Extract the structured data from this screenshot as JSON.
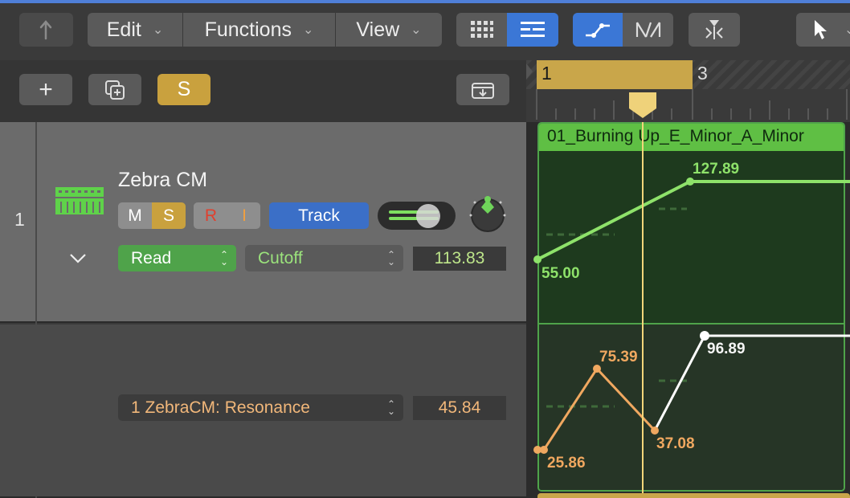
{
  "toolbar": {
    "back_icon": "back-arrow-icon",
    "edit_label": "Edit",
    "functions_label": "Functions",
    "view_label": "View",
    "grid_icon": "grid-view-icon",
    "list_icon": "list-view-icon",
    "automation_icon": "automation-curve-icon",
    "flex_icon": "flex-time-icon",
    "catch_icon": "catch-playhead-icon",
    "pointer_icon": "pointer-tool-icon"
  },
  "track_header": {
    "add_label": "+",
    "solo_label": "S"
  },
  "track1": {
    "number": "1",
    "name": "Zebra CM",
    "mute": "M",
    "solo": "S",
    "record": "R",
    "input": "I",
    "track_label": "Track",
    "mode": "Read",
    "parameter": "Cutoff",
    "value": "113.83",
    "colors": {
      "region": "#5fbf44",
      "curve": "#8ee26a"
    }
  },
  "track2": {
    "parameter": "1 ZebraCM: Resonance",
    "value": "45.84",
    "colors": {
      "curve": "#f0a860",
      "curve_after": "#ffffff"
    }
  },
  "ruler": {
    "bar1": "1",
    "bar3": "3"
  },
  "region": {
    "name": "01_Burning Up_E_Minor_A_Minor",
    "cutoff_points": [
      {
        "label": "55.00"
      },
      {
        "label": "127.89"
      }
    ],
    "resonance_points": [
      {
        "label": "25.86"
      },
      {
        "label": "75.39"
      },
      {
        "label": "37.08"
      },
      {
        "label": "96.89"
      }
    ]
  }
}
